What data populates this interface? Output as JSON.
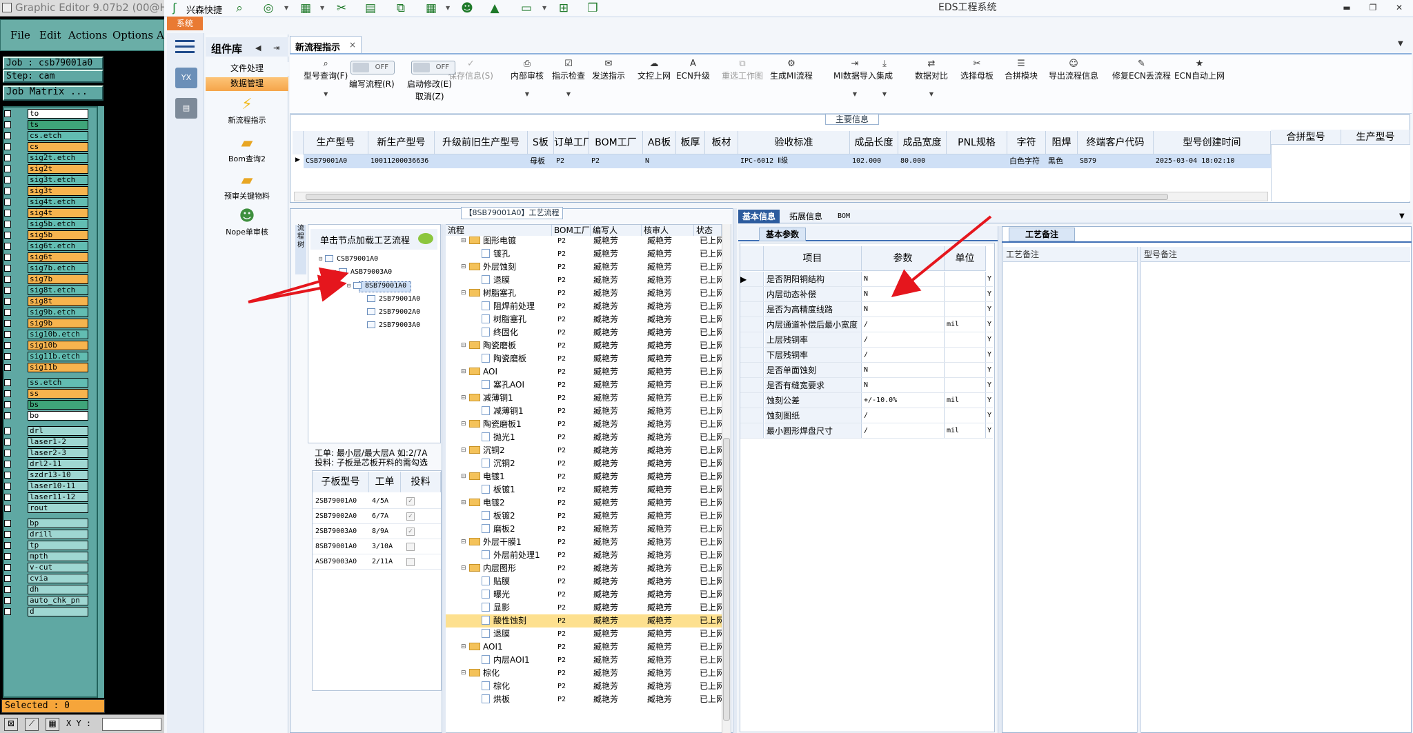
{
  "graphic_editor": {
    "title": "Graphic Editor 9.07b2 (00@H",
    "menu": [
      "File",
      "Edit",
      "Actions",
      "Options",
      "A"
    ],
    "job": "Job : csb79001a0",
    "step": "Step: cam",
    "job_matrix": "Job Matrix ...",
    "layers": [
      {
        "name": "to",
        "color": "w"
      },
      {
        "name": "ts",
        "color": "g"
      },
      {
        "name": "cs.etch",
        "color": "t"
      },
      {
        "name": "cs",
        "color": "o"
      },
      {
        "name": "sig2t.etch",
        "color": "t"
      },
      {
        "name": "sig2t",
        "color": "o"
      },
      {
        "name": "sig3t.etch",
        "color": "t"
      },
      {
        "name": "sig3t",
        "color": "o"
      },
      {
        "name": "sig4t.etch",
        "color": "t"
      },
      {
        "name": "sig4t",
        "color": "o"
      },
      {
        "name": "sig5b.etch",
        "color": "t"
      },
      {
        "name": "sig5b",
        "color": "o"
      },
      {
        "name": "sig6t.etch",
        "color": "t"
      },
      {
        "name": "sig6t",
        "color": "o"
      },
      {
        "name": "sig7b.etch",
        "color": "t"
      },
      {
        "name": "sig7b",
        "color": "o"
      },
      {
        "name": "sig8t.etch",
        "color": "t"
      },
      {
        "name": "sig8t",
        "color": "o"
      },
      {
        "name": "sig9b.etch",
        "color": "t"
      },
      {
        "name": "sig9b",
        "color": "o"
      },
      {
        "name": "sig10b.etch",
        "color": "t"
      },
      {
        "name": "sig10b",
        "color": "o"
      },
      {
        "name": "sig11b.etch",
        "color": "t"
      },
      {
        "name": "sig11b",
        "color": "o"
      },
      {
        "name": "ss.etch",
        "color": "t"
      },
      {
        "name": "ss",
        "color": "o"
      },
      {
        "name": "bs",
        "color": "g"
      },
      {
        "name": "bo",
        "color": "w"
      },
      {
        "name": "drl",
        "color": "s"
      },
      {
        "name": "laser1-2",
        "color": "s"
      },
      {
        "name": "laser2-3",
        "color": "s"
      },
      {
        "name": "drl2-11",
        "color": "s"
      },
      {
        "name": "szdr13-10",
        "color": "s"
      },
      {
        "name": "laser10-11",
        "color": "s"
      },
      {
        "name": "laser11-12",
        "color": "s"
      },
      {
        "name": "rout",
        "color": "s"
      },
      {
        "name": "bp",
        "color": "s"
      },
      {
        "name": "drill",
        "color": "s"
      },
      {
        "name": "tp",
        "color": "s"
      },
      {
        "name": "mpth",
        "color": "s"
      },
      {
        "name": "v-cut",
        "color": "s"
      },
      {
        "name": "cvia",
        "color": "s"
      },
      {
        "name": "dh",
        "color": "s"
      },
      {
        "name": "auto_chk_pn",
        "color": "s"
      },
      {
        "name": "d",
        "color": "s"
      }
    ],
    "selected": "Selected : 0",
    "xy_label": "X Y :"
  },
  "app": {
    "system_tab": "系统",
    "quick_launch": "兴森快捷",
    "title": "EDS工程系统",
    "component_lib": "组件库",
    "doc_processing": "文件处理",
    "data_mgmt": "数据管理",
    "nav_items": [
      {
        "label": "新流程指示",
        "icon": "lightning-icon"
      },
      {
        "label": "Bom查询2",
        "icon": "folder-icon"
      },
      {
        "label": "预审关键物料",
        "icon": "folder-icon"
      },
      {
        "label": "Nope单审核",
        "icon": "person-icon"
      }
    ],
    "doc_tab": "新流程指示",
    "doc_tab_close": "×"
  },
  "ribbon": {
    "items": [
      {
        "label": "型号查询(F)",
        "icon": "⌕"
      },
      {
        "label": "保存信息(S)",
        "icon": "✓",
        "disabled": true
      },
      {
        "label": "内部审核",
        "icon": "⎙"
      },
      {
        "label": "指示检查",
        "icon": "☑"
      },
      {
        "label": "发送指示",
        "icon": "✉"
      },
      {
        "label": "文控上网",
        "icon": "☁"
      },
      {
        "label": "ECN升级",
        "icon": "A"
      },
      {
        "label": "重选工作图",
        "icon": "⧉",
        "disabled": true
      },
      {
        "label": "生成MI流程",
        "icon": "⚙"
      },
      {
        "label": "MI数据导入",
        "icon": "⇥"
      },
      {
        "label": "集成",
        "icon": "⤓"
      },
      {
        "label": "数据对比",
        "icon": "⇄"
      },
      {
        "label": "选择母板",
        "icon": "✂"
      },
      {
        "label": "合拼模块",
        "icon": "☰"
      },
      {
        "label": "导出流程信息",
        "icon": "☺"
      },
      {
        "label": "修复ECN丢流程",
        "icon": "✎"
      },
      {
        "label": "ECN自动上网",
        "icon": "★"
      }
    ],
    "toggle1": {
      "state": "OFF",
      "label": "编写流程(R)"
    },
    "toggle2": {
      "state": "OFF",
      "label": "启动修改(E)",
      "label2": "取消(Z)"
    }
  },
  "main_info": {
    "group_label": "主要信息",
    "columns": [
      "生产型号",
      "新生产型号",
      "升级前旧生产型号",
      "S板",
      "订单工厂",
      "BOM工厂",
      "AB板",
      "板厚",
      "板材",
      "验收标准",
      "成品长度",
      "成品宽度",
      "PNL规格",
      "字符",
      "阻焊",
      "终端客户代码",
      "型号创建时间"
    ],
    "row": [
      "CSB79001A0",
      "10011200036636",
      "",
      "母板",
      "P2",
      "P2",
      "N",
      "",
      "",
      "IPC-6012 Ⅱ级",
      "102.000",
      "80.000",
      "",
      "白色字符",
      "黑色",
      "SB79",
      "2025-03-04 18:02:10"
    ],
    "merge_columns": [
      "合拼型号",
      "生产型号"
    ]
  },
  "process": {
    "title": "【8SB79001A0】工艺流程",
    "vertical_tab": "流程树",
    "tree_hint": "单击节点加载工艺流程",
    "tree": [
      "CSB79001A0",
      "ASB79003A0",
      "8SB79001A0",
      "2SB79001A0",
      "2SB79002A0",
      "2SB79003A0"
    ],
    "note_line1": "工单: 最小层/最大层A 如:2/7A",
    "note_line2": "投料: 子板是芯板开料的需勾选",
    "sub_columns": [
      "子板型号",
      "工单",
      "投料"
    ],
    "sub_rows": [
      {
        "model": "2SB79001A0",
        "order": "4/5A",
        "checked": true
      },
      {
        "model": "2SB79002A0",
        "order": "6/7A",
        "checked": true
      },
      {
        "model": "2SB79003A0",
        "order": "8/9A",
        "checked": true
      },
      {
        "model": "8SB79001A0",
        "order": "3/10A",
        "checked": false
      },
      {
        "model": "ASB79003A0",
        "order": "2/11A",
        "checked": false
      }
    ],
    "flow_columns": [
      "流程",
      "BOM工厂",
      "编写人",
      "核审人",
      "状态"
    ],
    "flow_rows": [
      {
        "name": "图形电镀",
        "folder": true,
        "f": "P2",
        "a": "臧艳芳",
        "b": "臧艳芳",
        "s": "已上网"
      },
      {
        "name": "镀孔",
        "folder": false,
        "f": "P2",
        "a": "臧艳芳",
        "b": "臧艳芳",
        "s": "已上网"
      },
      {
        "name": "外层蚀刻",
        "folder": true,
        "f": "P2",
        "a": "臧艳芳",
        "b": "臧艳芳",
        "s": "已上网"
      },
      {
        "name": "退膜",
        "folder": false,
        "f": "P2",
        "a": "臧艳芳",
        "b": "臧艳芳",
        "s": "已上网"
      },
      {
        "name": "树脂塞孔",
        "folder": true,
        "f": "P2",
        "a": "臧艳芳",
        "b": "臧艳芳",
        "s": "已上网"
      },
      {
        "name": "阻焊前处理",
        "folder": false,
        "f": "P2",
        "a": "臧艳芳",
        "b": "臧艳芳",
        "s": "已上网"
      },
      {
        "name": "树脂塞孔",
        "folder": false,
        "f": "P2",
        "a": "臧艳芳",
        "b": "臧艳芳",
        "s": "已上网"
      },
      {
        "name": "终固化",
        "folder": false,
        "f": "P2",
        "a": "臧艳芳",
        "b": "臧艳芳",
        "s": "已上网"
      },
      {
        "name": "陶瓷磨板",
        "folder": true,
        "f": "P2",
        "a": "臧艳芳",
        "b": "臧艳芳",
        "s": "已上网"
      },
      {
        "name": "陶瓷磨板",
        "folder": false,
        "f": "P2",
        "a": "臧艳芳",
        "b": "臧艳芳",
        "s": "已上网"
      },
      {
        "name": "AOI",
        "folder": true,
        "f": "P2",
        "a": "臧艳芳",
        "b": "臧艳芳",
        "s": "已上网"
      },
      {
        "name": "塞孔AOI",
        "folder": false,
        "f": "P2",
        "a": "臧艳芳",
        "b": "臧艳芳",
        "s": "已上网"
      },
      {
        "name": "减薄铜1",
        "folder": true,
        "f": "P2",
        "a": "臧艳芳",
        "b": "臧艳芳",
        "s": "已上网"
      },
      {
        "name": "减薄铜1",
        "folder": false,
        "f": "P2",
        "a": "臧艳芳",
        "b": "臧艳芳",
        "s": "已上网"
      },
      {
        "name": "陶瓷磨板1",
        "folder": true,
        "f": "P2",
        "a": "臧艳芳",
        "b": "臧艳芳",
        "s": "已上网"
      },
      {
        "name": "抛光1",
        "folder": false,
        "f": "P2",
        "a": "臧艳芳",
        "b": "臧艳芳",
        "s": "已上网"
      },
      {
        "name": "沉铜2",
        "folder": true,
        "f": "P2",
        "a": "臧艳芳",
        "b": "臧艳芳",
        "s": "已上网"
      },
      {
        "name": "沉铜2",
        "folder": false,
        "f": "P2",
        "a": "臧艳芳",
        "b": "臧艳芳",
        "s": "已上网"
      },
      {
        "name": "电镀1",
        "folder": true,
        "f": "P2",
        "a": "臧艳芳",
        "b": "臧艳芳",
        "s": "已上网"
      },
      {
        "name": "板镀1",
        "folder": false,
        "f": "P2",
        "a": "臧艳芳",
        "b": "臧艳芳",
        "s": "已上网"
      },
      {
        "name": "电镀2",
        "folder": true,
        "f": "P2",
        "a": "臧艳芳",
        "b": "臧艳芳",
        "s": "已上网"
      },
      {
        "name": "板镀2",
        "folder": false,
        "f": "P2",
        "a": "臧艳芳",
        "b": "臧艳芳",
        "s": "已上网"
      },
      {
        "name": "磨板2",
        "folder": false,
        "f": "P2",
        "a": "臧艳芳",
        "b": "臧艳芳",
        "s": "已上网"
      },
      {
        "name": "外层干膜1",
        "folder": true,
        "f": "P2",
        "a": "臧艳芳",
        "b": "臧艳芳",
        "s": "已上网"
      },
      {
        "name": "外层前处理1",
        "folder": false,
        "f": "P2",
        "a": "臧艳芳",
        "b": "臧艳芳",
        "s": "已上网"
      },
      {
        "name": "内层图形",
        "folder": true,
        "f": "P2",
        "a": "臧艳芳",
        "b": "臧艳芳",
        "s": "已上网"
      },
      {
        "name": "贴膜",
        "folder": false,
        "f": "P2",
        "a": "臧艳芳",
        "b": "臧艳芳",
        "s": "已上网"
      },
      {
        "name": "曝光",
        "folder": false,
        "f": "P2",
        "a": "臧艳芳",
        "b": "臧艳芳",
        "s": "已上网"
      },
      {
        "name": "显影",
        "folder": false,
        "f": "P2",
        "a": "臧艳芳",
        "b": "臧艳芳",
        "s": "已上网"
      },
      {
        "name": "酸性蚀刻",
        "folder": false,
        "f": "P2",
        "a": "臧艳芳",
        "b": "臧艳芳",
        "s": "已上网",
        "highlight": true
      },
      {
        "name": "退膜",
        "folder": false,
        "f": "P2",
        "a": "臧艳芳",
        "b": "臧艳芳",
        "s": "已上网"
      },
      {
        "name": "AOI1",
        "folder": true,
        "f": "P2",
        "a": "臧艳芳",
        "b": "臧艳芳",
        "s": "已上网"
      },
      {
        "name": "内层AOI1",
        "folder": false,
        "f": "P2",
        "a": "臧艳芳",
        "b": "臧艳芳",
        "s": "已上网"
      },
      {
        "name": "棕化",
        "folder": true,
        "f": "P2",
        "a": "臧艳芳",
        "b": "臧艳芳",
        "s": "已上网"
      },
      {
        "name": "棕化",
        "folder": false,
        "f": "P2",
        "a": "臧艳芳",
        "b": "臧艳芳",
        "s": "已上网"
      },
      {
        "name": "烘板",
        "folder": false,
        "f": "P2",
        "a": "臧艳芳",
        "b": "臧艳芳",
        "s": "已上网"
      }
    ]
  },
  "basic": {
    "tabs": [
      "基本信息",
      "拓展信息",
      "BOM"
    ],
    "sub_tab": "基本参数",
    "columns": [
      "项目",
      "参数",
      "单位"
    ],
    "rows": [
      {
        "item": "是否阴阳铜结构",
        "value": "N",
        "unit": "",
        "flag": "Y"
      },
      {
        "item": "内层动态补偿",
        "value": "N",
        "unit": "",
        "flag": "Y"
      },
      {
        "item": "是否为高精度线路",
        "value": "N",
        "unit": "",
        "flag": "Y"
      },
      {
        "item": "内层通道补偿后最小宽度",
        "value": "/",
        "unit": "mil",
        "flag": "Y"
      },
      {
        "item": "上层残铜率",
        "value": "/",
        "unit": "",
        "flag": "Y"
      },
      {
        "item": "下层残铜率",
        "value": "/",
        "unit": "",
        "flag": "Y"
      },
      {
        "item": "是否单面蚀刻",
        "value": "N",
        "unit": "",
        "flag": "Y"
      },
      {
        "item": "是否有缝宽要求",
        "value": "N",
        "unit": "",
        "flag": "Y"
      },
      {
        "item": "蚀刻公差",
        "value": "+/-10.0%",
        "unit": "mil",
        "flag": "Y"
      },
      {
        "item": "蚀刻图纸",
        "value": "/",
        "unit": "",
        "flag": "Y"
      },
      {
        "item": "最小圆形焊盘尺寸",
        "value": "/",
        "unit": "mil",
        "flag": "Y"
      }
    ],
    "note_tab": "工艺备注",
    "note_columns": [
      "工艺备注",
      "型号备注"
    ]
  }
}
